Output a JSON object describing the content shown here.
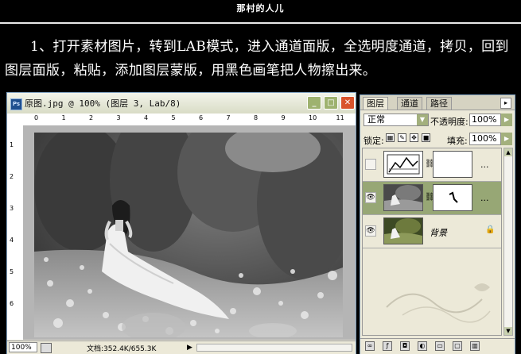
{
  "banner": {
    "title": "那村的人儿"
  },
  "instruction": {
    "text": "1、打开素材图片，转到LAB模式，进入通道面版，全选明度通道，拷贝，回到图层面版，粘贴，添加图层蒙版，用黑色画笔把人物擦出来。"
  },
  "document": {
    "title": "原图.jpg @ 100% (图层 3, Lab/8)",
    "app_icon": "Ps",
    "ruler_top_labels": [
      "0",
      "1",
      "2",
      "3",
      "4",
      "5",
      "6",
      "7",
      "8",
      "9",
      "10",
      "11"
    ],
    "ruler_left_labels": [
      "1",
      "2",
      "3",
      "4",
      "5",
      "6"
    ],
    "status": {
      "zoom": "100%",
      "doc_info": "文档:352.4K/655.3K"
    },
    "controls": {
      "minimize": "_",
      "maximize": "□",
      "close": "✕"
    }
  },
  "layers_panel": {
    "tabs": [
      "图层",
      "通道",
      "路径"
    ],
    "blend_mode": "正常",
    "opacity_label": "不透明度:",
    "opacity_value": "100%",
    "lock_label": "锁定:",
    "fill_label": "填充:",
    "fill_value": "100%",
    "layers": [
      {
        "name": "",
        "dots": "...",
        "visible": false,
        "selected": false
      },
      {
        "name": "",
        "dots": "...",
        "visible": true,
        "selected": true
      },
      {
        "name": "背景",
        "visible": true,
        "selected": false,
        "locked": true
      }
    ]
  },
  "colors": {
    "accent": "#97a775",
    "close_button": "#d9532b",
    "window_border": "#7b9dbd"
  },
  "icons": [
    "ps-app-icon",
    "eye-icon",
    "chain-link-icon",
    "lock-icon",
    "levels-adjustment-icon",
    "link-layers-icon",
    "fx-icon",
    "mask-icon",
    "adjustment-icon",
    "folder-icon",
    "new-layer-icon",
    "trash-icon"
  ]
}
